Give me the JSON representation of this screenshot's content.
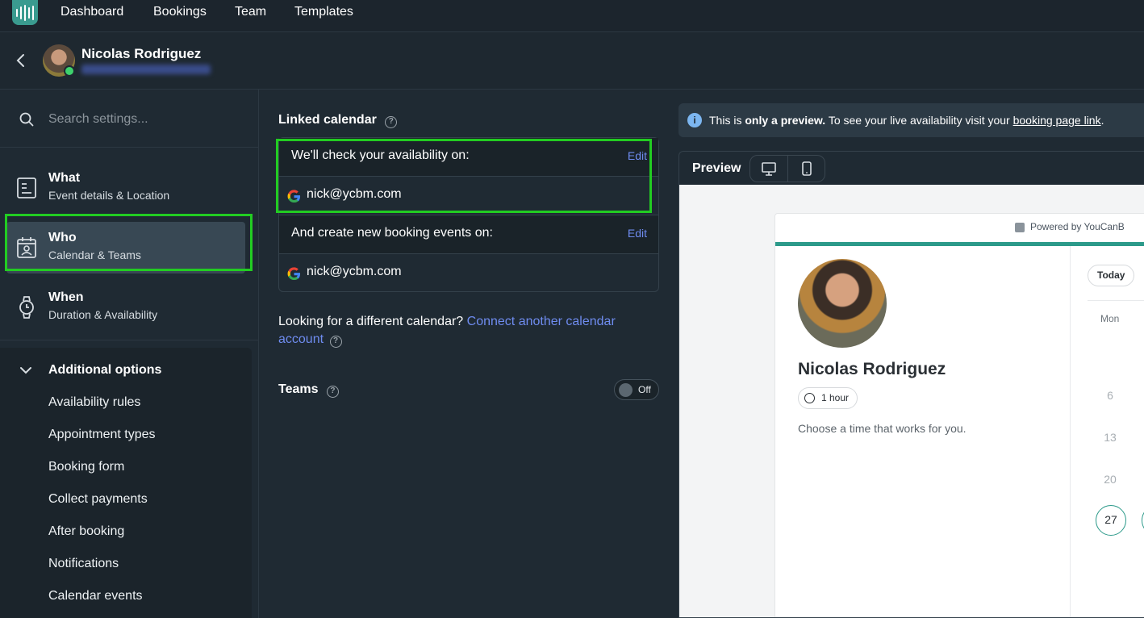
{
  "topnav": {
    "links": [
      "Dashboard",
      "Bookings",
      "Team",
      "Templates"
    ]
  },
  "header": {
    "name": "Nicolas Rodriguez"
  },
  "sidebar": {
    "search_placeholder": "Search settings...",
    "items": [
      {
        "title": "What",
        "subtitle": "Event details & Location"
      },
      {
        "title": "Who",
        "subtitle": "Calendar & Teams"
      },
      {
        "title": "When",
        "subtitle": "Duration & Availability"
      }
    ],
    "additional": {
      "title": "Additional options",
      "items": [
        "Availability rules",
        "Appointment types",
        "Booking form",
        "Collect payments",
        "After booking",
        "Notifications",
        "Calendar events"
      ]
    }
  },
  "main": {
    "linked_title": "Linked calendar",
    "check_label": "We'll check your availability on:",
    "create_label": "And create new booking events on:",
    "edit": "Edit",
    "check_email": "nick@ycbm.com",
    "create_email": "nick@ycbm.com",
    "different_text": "Looking for a different calendar?",
    "connect_link": "Connect another calendar account",
    "teams_title": "Teams",
    "teams_toggle": "Off"
  },
  "preview": {
    "banner_pre": "This is",
    "banner_bold": "only a preview.",
    "banner_mid": "To see your live availability visit your",
    "banner_link": "booking page link",
    "banner_end": ".",
    "label": "Preview",
    "powered": "Powered by YouCanB",
    "name": "Nicolas Rodriguez",
    "duration": "1 hour",
    "choose": "Choose a time that works for you.",
    "today": "Today",
    "weekday": "Mon",
    "days": [
      "6",
      "13",
      "20"
    ],
    "selected_day": "27"
  },
  "colors": {
    "accent": "#2c9a8a",
    "highlight": "#22cc22",
    "link": "#6f8cf0"
  }
}
